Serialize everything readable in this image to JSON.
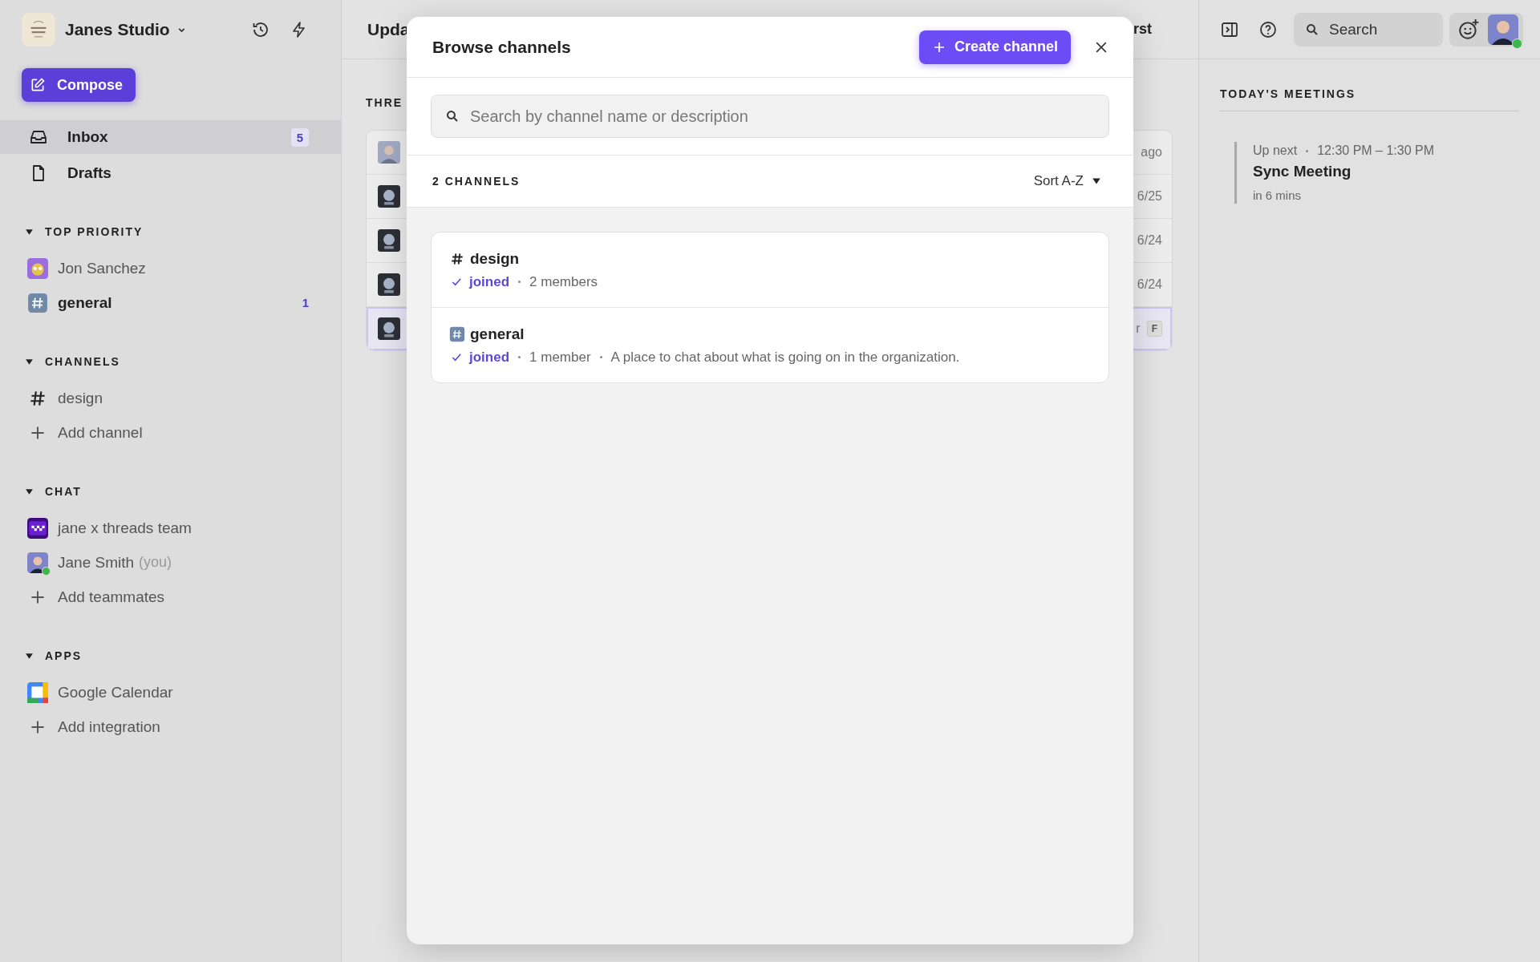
{
  "sidebar": {
    "workspace": "Janes Studio",
    "compose": "Compose",
    "nav": [
      {
        "kind": "inbox",
        "label": "Inbox",
        "badge": "5",
        "selected": true
      },
      {
        "kind": "file",
        "label": "Drafts",
        "selected": false
      }
    ],
    "sections": [
      {
        "title": "TOP PRIORITY",
        "expanded": true,
        "items": [
          {
            "kind": "avatar",
            "label": "Jon Sanchez",
            "unread": false
          },
          {
            "kind": "emoji-hash",
            "label": "general",
            "count": "1",
            "unread": true
          }
        ]
      },
      {
        "title": "CHANNELS",
        "expanded": true,
        "items": [
          {
            "kind": "hash",
            "label": "design",
            "unread": false
          },
          {
            "kind": "add",
            "label": "Add channel",
            "unread": false
          }
        ]
      },
      {
        "title": "CHAT",
        "expanded": true,
        "items": [
          {
            "kind": "team",
            "label": "jane x threads team",
            "unread": false
          },
          {
            "kind": "person",
            "label": "Jane Smith",
            "suffix": "(you)",
            "online": true,
            "unread": false
          },
          {
            "kind": "add",
            "label": "Add teammates",
            "unread": false
          }
        ]
      },
      {
        "title": "APPS",
        "expanded": true,
        "items": [
          {
            "kind": "calendar",
            "label": "Google Calendar",
            "unread": false
          },
          {
            "kind": "add",
            "label": "Add integration",
            "unread": false
          }
        ]
      }
    ]
  },
  "main": {
    "title": "Upda",
    "header_right": "rst",
    "section_label": "THRE",
    "rows": [
      {
        "kind": "person",
        "meta": "ago",
        "selected": false
      },
      {
        "kind": "bot",
        "meta": "6/25",
        "selected": false
      },
      {
        "kind": "bot",
        "meta": "6/24",
        "selected": false
      },
      {
        "kind": "bot",
        "meta": "6/24",
        "selected": false
      },
      {
        "kind": "bot",
        "meta": "r",
        "key": "F",
        "selected": true
      }
    ]
  },
  "modal": {
    "title": "Browse channels",
    "create_button": "Create channel",
    "search": {
      "placeholder": "Search by channel name or description"
    },
    "count": "2 CHANNELS",
    "sort": "Sort A-Z",
    "channels": [
      {
        "kind": "hash",
        "name": "design",
        "joined": true,
        "status": "joined",
        "members": "2 members"
      },
      {
        "kind": "emoji-hash",
        "name": "general",
        "joined": true,
        "status": "joined",
        "members": "1 member",
        "description": "A place to chat about what is going on in the organization."
      }
    ]
  },
  "right_panel": {
    "search": {
      "placeholder": "Search"
    },
    "online": true,
    "meetings_title": "TODAY'S MEETINGS",
    "meetings": [
      {
        "label": "Up next",
        "time": "12:30 PM – 1:30 PM",
        "title": "Sync Meeting",
        "relative": "in 6 mins"
      }
    ]
  }
}
